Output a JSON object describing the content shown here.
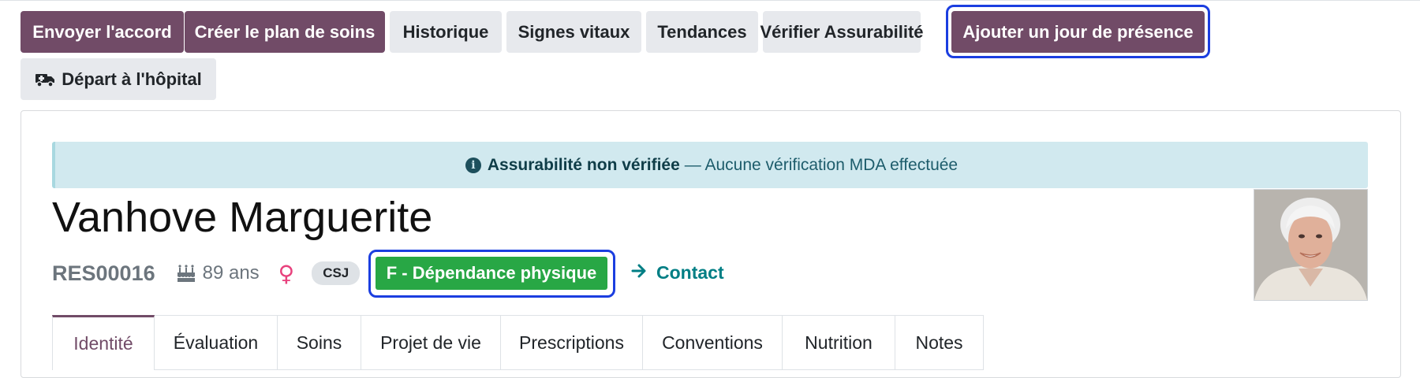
{
  "toolbar": {
    "send_agreement": "Envoyer l'accord",
    "create_care_plan": "Créer le plan de soins",
    "history": "Historique",
    "vital_signs": "Signes vitaux",
    "trends": "Tendances",
    "check_insurability": "Vérifier Assurabilité",
    "add_attendance_day": "Ajouter un jour de présence",
    "hospital_departure": "Départ à l'hôpital"
  },
  "alert": {
    "title": "Assurabilité non vérifiée",
    "message": "— Aucune vérification MDA effectuée",
    "icon": "info-icon"
  },
  "resident": {
    "name": "Vanhove Marguerite",
    "reference": "RES00016",
    "age": "89 ans",
    "gender_symbol": "♀",
    "tag": "CSJ",
    "dependency": "F - Dépendance physique",
    "contact_label": "Contact"
  },
  "tabs": [
    "Identité",
    "Évaluation",
    "Soins",
    "Projet de vie",
    "Prescriptions",
    "Conventions",
    "Nutrition",
    "Notes"
  ],
  "colors": {
    "primary": "#714b67",
    "secondary": "#e7e9ed",
    "success": "#28a745",
    "info_bg": "#d1e9ef",
    "focus": "#1b3ee0",
    "link": "#017e84"
  }
}
